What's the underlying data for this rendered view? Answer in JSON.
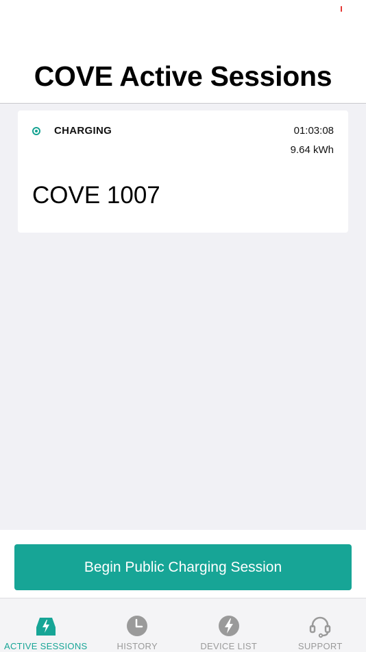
{
  "header": {
    "title": "COVE Active Sessions"
  },
  "session": {
    "status": "CHARGING",
    "duration": "01:03:08",
    "energy": "9.64 kWh",
    "device": "COVE 1007"
  },
  "action": {
    "begin_label": "Begin Public Charging Session"
  },
  "tabs": [
    {
      "label": "ACTIVE SESSIONS",
      "icon": "car-charging-icon",
      "active": true
    },
    {
      "label": "HISTORY",
      "icon": "clock-icon",
      "active": false
    },
    {
      "label": "DEVICE LIST",
      "icon": "lightning-icon",
      "active": false
    },
    {
      "label": "SUPPORT",
      "icon": "headset-icon",
      "active": false
    }
  ],
  "colors": {
    "accent": "#17a596",
    "inactive": "#9a9a9a",
    "background": "#f1f1f5"
  }
}
